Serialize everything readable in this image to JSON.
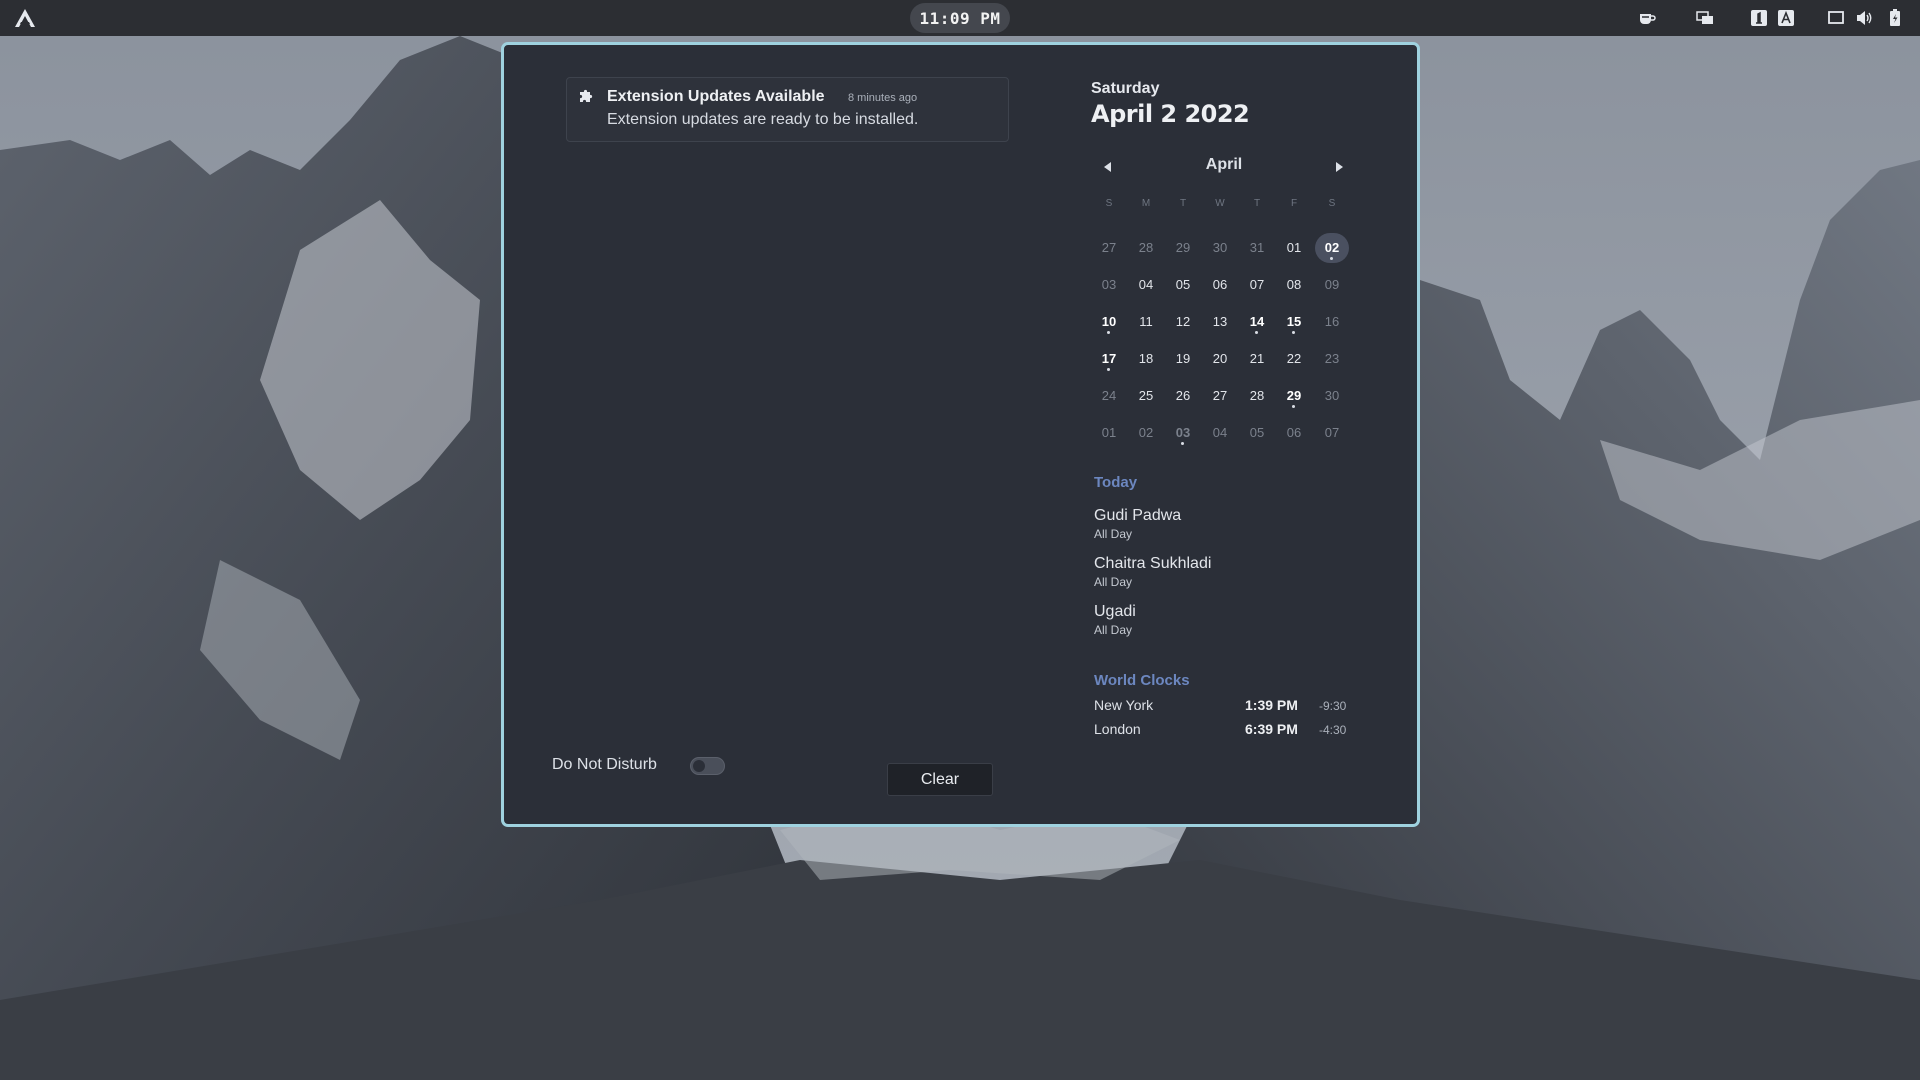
{
  "topbar": {
    "clock": "11:09 PM",
    "icons": [
      "activities-icon",
      "coffee-icon",
      "screens-icon",
      "keyboard-1-icon",
      "keyboard-a-icon",
      "display-icon",
      "volume-icon",
      "battery-icon"
    ]
  },
  "notification": {
    "icon": "puzzle-icon",
    "title": "Extension Updates Available",
    "time": "8 minutes ago",
    "body": "Extension updates are ready to be installed."
  },
  "dnd": {
    "label": "Do Not Disturb",
    "enabled": false
  },
  "clear_label": "Clear",
  "date_header": {
    "weekday": "Saturday",
    "full_date": "April 2 2022"
  },
  "calendar": {
    "month": "April",
    "weekdays": [
      "S",
      "M",
      "T",
      "W",
      "T",
      "F",
      "S"
    ],
    "weeks": [
      [
        {
          "d": "27",
          "o": true
        },
        {
          "d": "28",
          "o": true
        },
        {
          "d": "29",
          "o": true
        },
        {
          "d": "30",
          "o": true
        },
        {
          "d": "31",
          "o": true
        },
        {
          "d": "01"
        },
        {
          "d": "02",
          "today": true,
          "event": true
        }
      ],
      [
        {
          "d": "03",
          "w": true
        },
        {
          "d": "04"
        },
        {
          "d": "05"
        },
        {
          "d": "06"
        },
        {
          "d": "07"
        },
        {
          "d": "08"
        },
        {
          "d": "09",
          "w": true
        }
      ],
      [
        {
          "d": "10",
          "bold": true,
          "event": true
        },
        {
          "d": "11"
        },
        {
          "d": "12"
        },
        {
          "d": "13"
        },
        {
          "d": "14",
          "bold": true,
          "event": true
        },
        {
          "d": "15",
          "bold": true,
          "event": true
        },
        {
          "d": "16",
          "w": true
        }
      ],
      [
        {
          "d": "17",
          "bold": true,
          "event": true
        },
        {
          "d": "18"
        },
        {
          "d": "19"
        },
        {
          "d": "20"
        },
        {
          "d": "21"
        },
        {
          "d": "22"
        },
        {
          "d": "23",
          "w": true
        }
      ],
      [
        {
          "d": "24",
          "w": true
        },
        {
          "d": "25"
        },
        {
          "d": "26"
        },
        {
          "d": "27"
        },
        {
          "d": "28"
        },
        {
          "d": "29",
          "bold": true,
          "event": true
        },
        {
          "d": "30",
          "w": true
        }
      ],
      [
        {
          "d": "01",
          "o": true
        },
        {
          "d": "02",
          "o": true
        },
        {
          "d": "03",
          "o": true,
          "bold": true,
          "event": true
        },
        {
          "d": "04",
          "o": true
        },
        {
          "d": "05",
          "o": true
        },
        {
          "d": "06",
          "o": true
        },
        {
          "d": "07",
          "o": true
        }
      ]
    ]
  },
  "today": {
    "title": "Today",
    "events": [
      {
        "name": "Gudi Padwa",
        "time": "All Day"
      },
      {
        "name": "Chaitra Sukhladi",
        "time": "All Day"
      },
      {
        "name": "Ugadi",
        "time": "All Day"
      }
    ]
  },
  "world_clocks": {
    "title": "World Clocks",
    "clocks": [
      {
        "city": "New York",
        "time": "1:39 PM",
        "offset": "-9:30"
      },
      {
        "city": "London",
        "time": "6:39 PM",
        "offset": "-4:30"
      }
    ]
  },
  "colors": {
    "accent": "#9fd2df",
    "section_title": "#6c87c0",
    "popup_bg": "#2b2f38",
    "topbar_bg": "#2c2e33"
  }
}
